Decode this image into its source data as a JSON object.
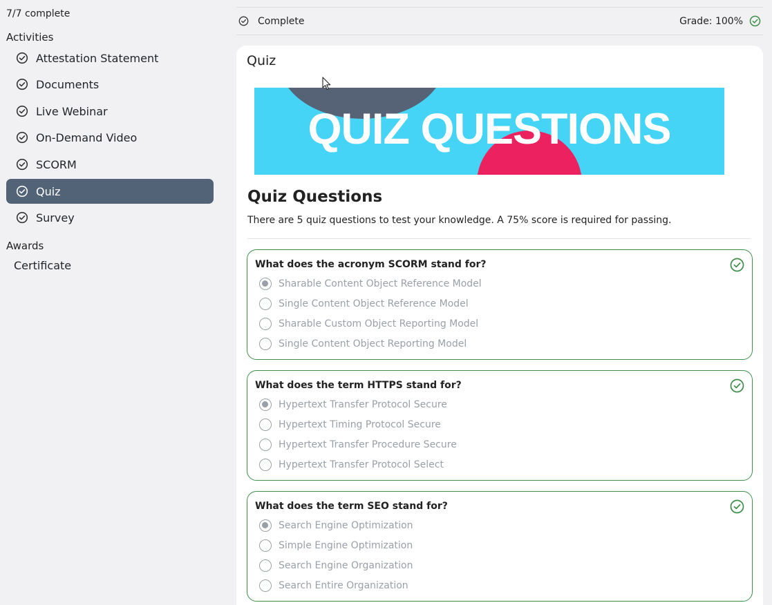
{
  "sidebar": {
    "progress": "7/7 complete",
    "activities_label": "Activities",
    "items": [
      {
        "label": "Attestation Statement",
        "icon": "check-circle-icon"
      },
      {
        "label": "Documents",
        "icon": "check-circle-icon"
      },
      {
        "label": "Live Webinar",
        "icon": "check-circle-icon"
      },
      {
        "label": "On-Demand Video",
        "icon": "check-circle-icon"
      },
      {
        "label": "SCORM",
        "icon": "check-circle-icon"
      },
      {
        "label": "Quiz",
        "icon": "check-circle-icon",
        "active": true
      },
      {
        "label": "Survey",
        "icon": "check-circle-icon"
      }
    ],
    "awards_label": "Awards",
    "certificate_label": "Certificate",
    "active_color": "#536377"
  },
  "status": {
    "state": "Complete",
    "grade": "Grade: 100%",
    "success_color": "#3e8e4a"
  },
  "main": {
    "title": "Quiz",
    "banner_text": "QUIZ QUESTIONS",
    "heading": "Quiz Questions",
    "description": "There are 5 quiz questions to test your knowledge. A 75% score is required for passing.",
    "questions": [
      {
        "text": "What does the acronym SCORM stand for?",
        "options": [
          "Sharable Content Object Reference Model",
          "Single Content Object Reference Model",
          "Sharable Custom Object Reporting Model",
          "Single Content Object Reporting Model"
        ],
        "selected": 0
      },
      {
        "text": "What does the term HTTPS stand for?",
        "options": [
          "Hypertext Transfer Protocol Secure",
          "Hypertext Timing Protocol Secure",
          "Hypertext Transfer Procedure Secure",
          "Hypertext Transfer Protocol Select"
        ],
        "selected": 0
      },
      {
        "text": "What does the term SEO stand for?",
        "options": [
          "Search Engine Optimization",
          "Simple Engine Optimization",
          "Search Engine Organization",
          "Search Entire Organization"
        ],
        "selected": 0
      }
    ]
  },
  "colors": {
    "banner_bg": "#45d3f6",
    "banner_circle_dark": "#566377",
    "banner_circle_pink": "#ec2260"
  }
}
